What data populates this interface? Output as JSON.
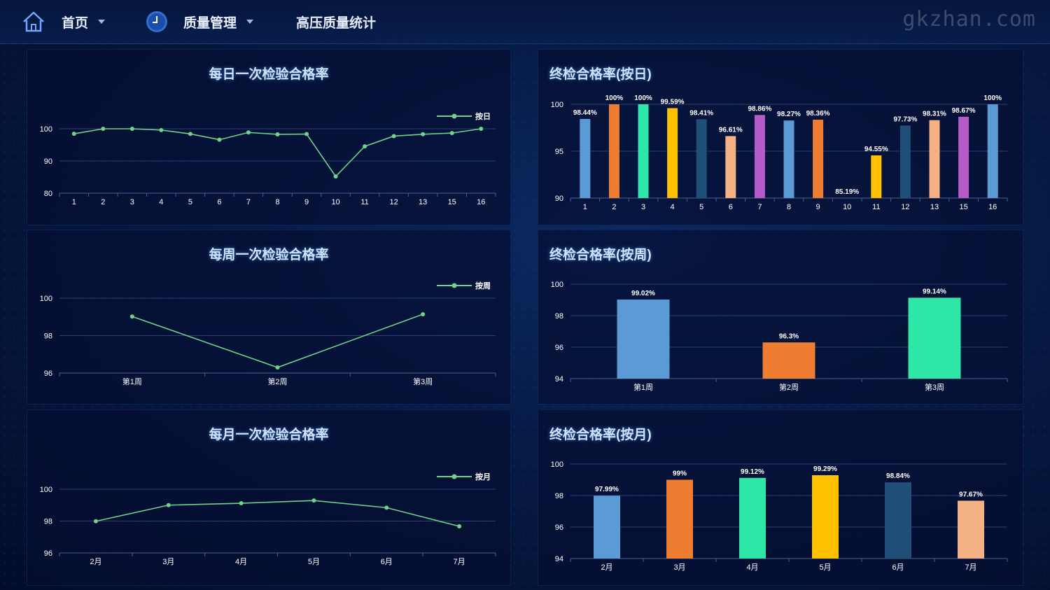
{
  "nav": {
    "home_label": "首页",
    "section_label": "质量管理",
    "page_label": "高压质量统计",
    "watermark": "gkzhan.com",
    "icons": [
      "home-icon",
      "clock-icon",
      "chevron-down-icon"
    ]
  },
  "colors": {
    "line": "#6fd38b",
    "grid": "#2a3f72",
    "axis_text": "#ffffff",
    "title": "#cfe3ff",
    "bar_palette": [
      "#5b9bd5",
      "#ed7d31",
      "#2ee6a6",
      "#ffc000",
      "#1f4e79",
      "#f4b183",
      "#b65cc8"
    ]
  },
  "panels": {
    "daily_line_title": "每日一次检验合格率",
    "weekly_line_title": "每周一次检验合格率",
    "monthly_line_title": "每月一次检验合格率",
    "daily_bar_title": "终检合格率(按日)",
    "weekly_bar_title": "终检合格率(按周)",
    "monthly_bar_title": "终检合格率(按月)"
  },
  "chart_data": [
    {
      "id": "daily_line",
      "type": "line",
      "title": "每日一次检验合格率",
      "categories": [
        "1",
        "2",
        "3",
        "4",
        "5",
        "6",
        "7",
        "8",
        "9",
        "10",
        "11",
        "12",
        "13",
        "15",
        "16"
      ],
      "series": [
        {
          "name": "按日",
          "values": [
            98.44,
            100,
            100,
            99.59,
            98.41,
            96.61,
            98.86,
            98.27,
            98.36,
            85.19,
            94.55,
            97.73,
            98.31,
            98.67,
            100
          ]
        }
      ],
      "yticks": [
        80,
        90,
        100
      ],
      "ylim": [
        80,
        100
      ],
      "legend": "top-right",
      "grid": true
    },
    {
      "id": "weekly_line",
      "type": "line",
      "title": "每周一次检验合格率",
      "categories": [
        "第1周",
        "第2周",
        "第3周"
      ],
      "series": [
        {
          "name": "按周",
          "values": [
            99.02,
            96.3,
            99.14
          ]
        }
      ],
      "yticks": [
        96,
        98,
        100
      ],
      "ylim": [
        96,
        100
      ],
      "legend": "top-right",
      "grid": true
    },
    {
      "id": "monthly_line",
      "type": "line",
      "title": "每月一次检验合格率",
      "categories": [
        "2月",
        "3月",
        "4月",
        "5月",
        "6月",
        "7月"
      ],
      "series": [
        {
          "name": "按月",
          "values": [
            97.99,
            99,
            99.12,
            99.29,
            98.84,
            97.67
          ]
        }
      ],
      "yticks": [
        96,
        98,
        100
      ],
      "ylim": [
        96,
        100
      ],
      "legend": "top-right",
      "grid": true
    },
    {
      "id": "daily_bar",
      "type": "bar",
      "title": "终检合格率(按日)",
      "categories": [
        "1",
        "2",
        "3",
        "4",
        "5",
        "6",
        "7",
        "8",
        "9",
        "10",
        "11",
        "12",
        "13",
        "15",
        "16"
      ],
      "values": [
        98.44,
        100,
        100,
        99.59,
        98.41,
        96.61,
        98.86,
        98.27,
        98.36,
        85.19,
        94.55,
        97.73,
        98.31,
        98.67,
        100
      ],
      "labels": [
        "98.44%",
        "100%",
        "100%",
        "99.59%",
        "98.41%",
        "96.61%",
        "98.86%",
        "98.27%",
        "98.36%",
        "85.19%",
        "94.55%",
        "97.73%",
        "98.31%",
        "98.67%",
        "100%"
      ],
      "yticks": [
        90,
        95,
        100
      ],
      "ylim": [
        90,
        100
      ],
      "grid": true
    },
    {
      "id": "weekly_bar",
      "type": "bar",
      "title": "终检合格率(按周)",
      "categories": [
        "第1周",
        "第2周",
        "第3周"
      ],
      "values": [
        99.02,
        96.3,
        99.14
      ],
      "labels": [
        "99.02%",
        "96.3%",
        "99.14%"
      ],
      "yticks": [
        94,
        96,
        98,
        100
      ],
      "ylim": [
        94,
        100
      ],
      "grid": true
    },
    {
      "id": "monthly_bar",
      "type": "bar",
      "title": "终检合格率(按月)",
      "categories": [
        "2月",
        "3月",
        "4月",
        "5月",
        "6月",
        "7月"
      ],
      "values": [
        97.99,
        99,
        99.12,
        99.29,
        98.84,
        97.67
      ],
      "labels": [
        "97.99%",
        "99%",
        "99.12%",
        "99.29%",
        "98.84%",
        "97.67%"
      ],
      "yticks": [
        94,
        96,
        98,
        100
      ],
      "ylim": [
        94,
        100
      ],
      "grid": true
    }
  ]
}
